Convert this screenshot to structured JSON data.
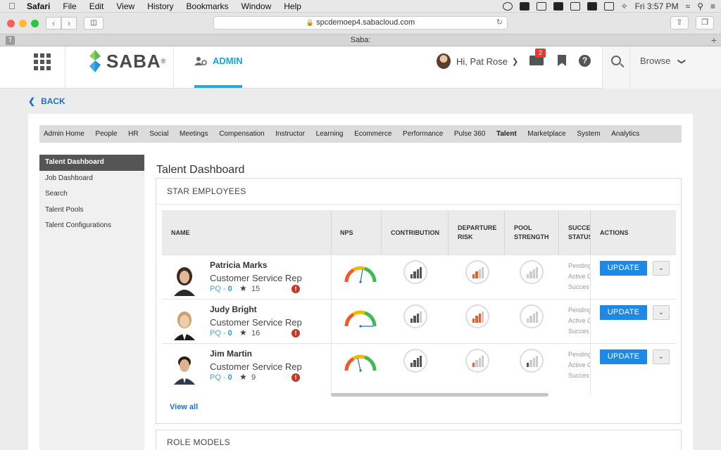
{
  "menubar": {
    "items": [
      "Safari",
      "File",
      "Edit",
      "View",
      "History",
      "Bookmarks",
      "Window",
      "Help"
    ],
    "clock": "Fri 3:57 PM"
  },
  "browser": {
    "url": "spcdemoep4.sabacloud.com",
    "tab_title": "Saba:",
    "tab_icon_letter": "T"
  },
  "header": {
    "logo": "SABA",
    "logo_mark": "®",
    "admin_label": "ADMIN",
    "greeting": "Hi, Pat Rose",
    "mail_count": "2",
    "help_glyph": "?",
    "browse_label": "Browse"
  },
  "back_label": "BACK",
  "topnav": [
    "Admin Home",
    "People",
    "HR",
    "Social",
    "Meetings",
    "Compensation",
    "Instructor",
    "Learning",
    "Ecommerce",
    "Performance",
    "Pulse 360",
    "Talent",
    "Marketplace",
    "System",
    "Analytics"
  ],
  "topnav_active": "Talent",
  "leftnav": [
    "Talent Dashboard",
    "Job Dashboard",
    "Search",
    "Talent Pools",
    "Talent Configurations"
  ],
  "page_title": "Talent Dashboard",
  "star_section": {
    "title": "STAR EMPLOYEES",
    "columns": {
      "name": "NAME",
      "nps": "NPS",
      "contribution": "CONTRIBUTION",
      "departure1": "DEPARTURE",
      "departure2": "RISK",
      "pool1": "POOL",
      "pool2": "STRENGTH",
      "success1": "SUCCES",
      "success2": "STATUS",
      "actions": "ACTIONS"
    },
    "rows": [
      {
        "name": "Patricia Marks",
        "role": "Customer Service Rep",
        "pq_label": "PQ - ",
        "pq_value": "0",
        "stars": "15",
        "status": [
          "Pending",
          "Active C",
          "Succes"
        ],
        "update_label": "UPDATE"
      },
      {
        "name": "Judy Bright",
        "role": "Customer Service Rep",
        "pq_label": "PQ - ",
        "pq_value": "0",
        "stars": "16",
        "status": [
          "Pending",
          "Active C",
          "Succes"
        ],
        "update_label": "UPDATE"
      },
      {
        "name": "Jim Martin",
        "role": "Customer Service Rep",
        "pq_label": "PQ - ",
        "pq_value": "0",
        "stars": "9",
        "status": [
          "Pending",
          "Active C",
          "Succes"
        ],
        "update_label": "UPDATE"
      }
    ],
    "view_all": "View all"
  },
  "role_models_title": "ROLE MODELS",
  "colors": {
    "accent": "#1d9fd8",
    "update_button": "#1e88e5",
    "alert": "#c0392b",
    "bar_dark": "#555555",
    "bar_red": "#f05a28",
    "bar_light": "#cccccc"
  },
  "icons": [
    "apple-icon",
    "grid-menu-icon",
    "saba-logo-icon",
    "admin-gear-icon",
    "mail-icon",
    "bookmark-icon",
    "help-icon",
    "search-icon",
    "chevron-down-icon",
    "back-chevron-icon",
    "star-icon",
    "alert-icon",
    "gauge-icon",
    "bar-chart-icon"
  ]
}
